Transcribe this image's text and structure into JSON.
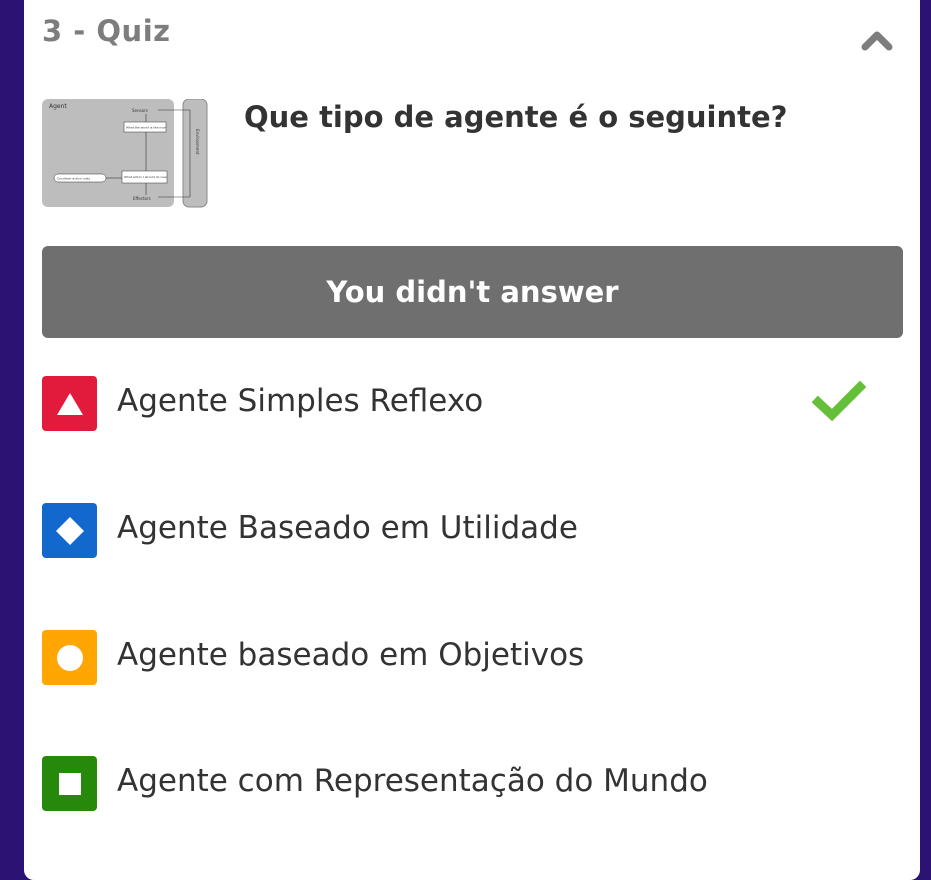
{
  "quiz": {
    "title": "3 - Quiz",
    "collapse_icon": "chevron-up-icon",
    "image": {
      "labels": {
        "agent": "Agent",
        "sensors": "Sensors",
        "what_world": "What the world is like now",
        "rules": "Condition-action rules",
        "action": "What action I should do now",
        "effectors": "Effectors",
        "environment": "Environment"
      }
    },
    "question": "Que tipo de agente é o seguinte?",
    "status": "You didn't answer",
    "answers": [
      {
        "label": "Agente Simples Reflexo",
        "shape": "triangle-icon",
        "color": "#e21b3c",
        "correct": true
      },
      {
        "label": "Agente Baseado em Utilidade",
        "shape": "diamond-icon",
        "color": "#1368ce",
        "correct": false
      },
      {
        "label": "Agente baseado em Objetivos",
        "shape": "circle-icon",
        "color": "#ffa602",
        "correct": false
      },
      {
        "label": "Agente com Representação do Mundo",
        "shape": "square-icon",
        "color": "#26890c",
        "correct": false
      }
    ],
    "check_color": "#66bf39",
    "check_icon": "checkmark-icon"
  }
}
